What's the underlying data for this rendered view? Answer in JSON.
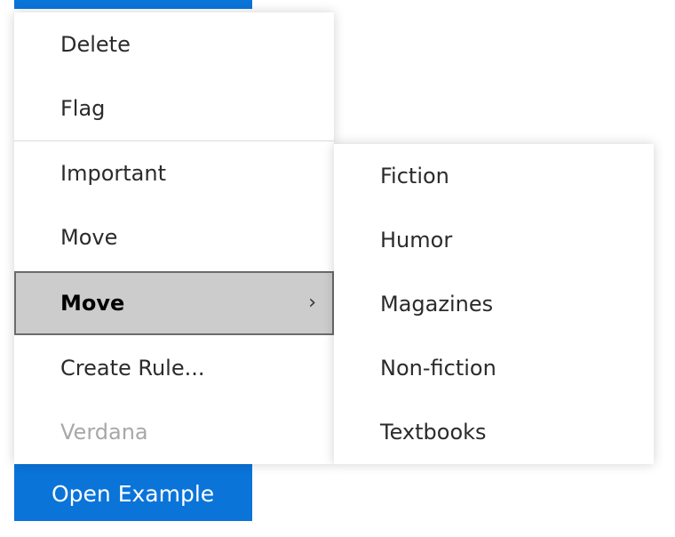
{
  "menu": {
    "items": [
      {
        "label": "Delete"
      },
      {
        "label": "Flag"
      },
      {
        "label": "Important"
      },
      {
        "label": "Move"
      },
      {
        "label": "Move",
        "selected": true,
        "submenu_icon": "›"
      },
      {
        "label": "Create Rule..."
      },
      {
        "label": "Verdana",
        "disabled": true
      }
    ]
  },
  "submenu": {
    "items": [
      {
        "label": "Fiction"
      },
      {
        "label": "Humor"
      },
      {
        "label": "Magazines"
      },
      {
        "label": "Non-fiction"
      },
      {
        "label": "Textbooks"
      }
    ]
  },
  "button": {
    "label": "Open Example"
  },
  "colors": {
    "accent": "#0a74d9",
    "selected_bg": "#cccccc",
    "selected_border": "#6b6b6b",
    "disabled_text": "#a8a8a8"
  },
  "icons": {
    "submenu_arrow": "chevron-right-icon"
  }
}
